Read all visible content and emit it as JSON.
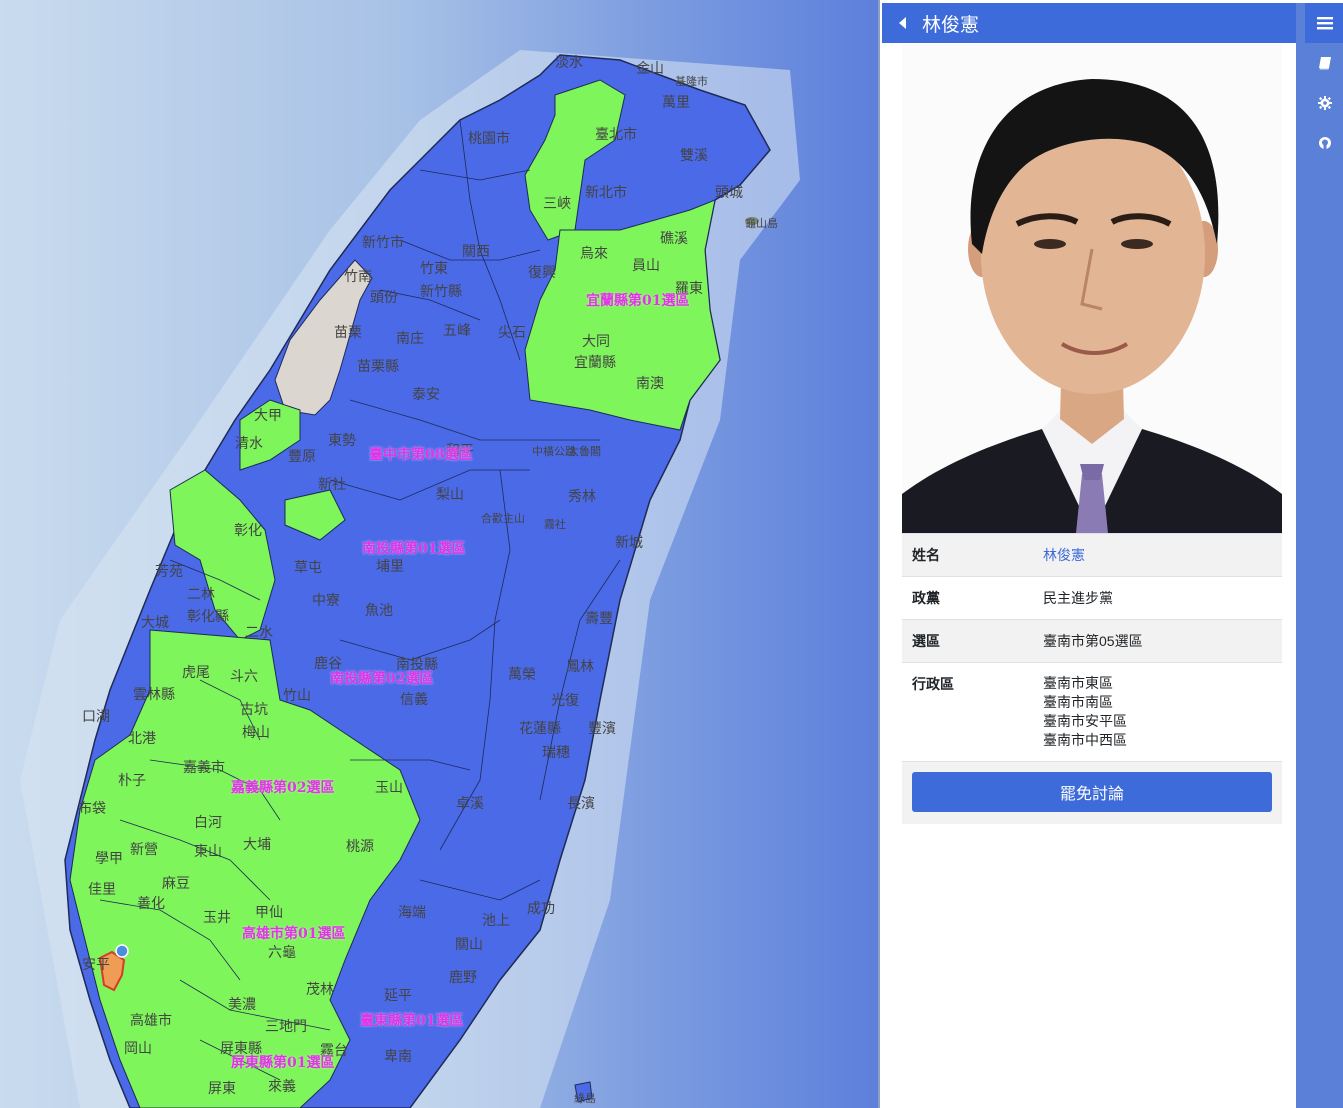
{
  "sidebar": {
    "title": "林俊憲",
    "back_icon": "caret-left-icon",
    "tabs": [
      {
        "icon": "menu-icon"
      },
      {
        "icon": "book-icon"
      },
      {
        "icon": "gear-icon"
      },
      {
        "icon": "github-icon"
      }
    ],
    "info": {
      "name_label": "姓名",
      "name_value": "林俊憲",
      "party_label": "政黨",
      "party_value": "民主進步黨",
      "constituency_label": "選區",
      "constituency_value": "臺南市第05選區",
      "district_label": "行政區",
      "districts": [
        "臺南市東區",
        "臺南市南區",
        "臺南市安平區",
        "臺南市中西區"
      ]
    },
    "recall_button": "罷免討論"
  },
  "map": {
    "colors": {
      "dpp": "#7ef55a",
      "kmt": "#4a6ae8",
      "selected": "#ef9d55",
      "other": "#dcd6d0"
    },
    "district_labels": [
      "宜蘭縣第01選區",
      "臺中市第08選區",
      "南投縣第01選區",
      "南投縣第02選區",
      "嘉義縣第02選區",
      "高雄市第01選區",
      "臺東縣第01選區",
      "屏東縣第01選區"
    ],
    "place_labels": [
      "淡水",
      "金山",
      "基隆市",
      "萬里",
      "桃園市",
      "臺北市",
      "雙溪",
      "新北市",
      "頭城",
      "龜山島",
      "三峽",
      "新竹市",
      "關西",
      "竹東",
      "新竹縣",
      "復興",
      "烏來",
      "礁溪",
      "員山",
      "羅東",
      "竹南",
      "頭份",
      "苗栗",
      "南庄",
      "五峰",
      "尖石",
      "大同",
      "宜蘭縣",
      "苗栗縣",
      "泰安",
      "南澳",
      "大甲",
      "和平",
      "清水",
      "中橫公路",
      "太魯閣",
      "東勢",
      "豐原",
      "新社",
      "梨山",
      "秀林",
      "合歡主山",
      "彰化",
      "霧社",
      "新城",
      "芳苑",
      "二林",
      "彰化縣",
      "草屯",
      "埔里",
      "中寮",
      "魚池",
      "二水",
      "壽豐",
      "大城",
      "竹山",
      "南投縣",
      "鹿谷",
      "斗六",
      "信義",
      "鳳林",
      "雲林縣",
      "虎尾",
      "萬榮",
      "古坑",
      "光復",
      "口湖",
      "北港",
      "梅山",
      "花蓮縣",
      "豐濱",
      "瑞穗",
      "朴子",
      "嘉義市",
      "布袋",
      "白河",
      "大埔",
      "玉山",
      "長濱",
      "卓溪",
      "新營",
      "東山",
      "學甲",
      "佳里",
      "麻豆",
      "桃源",
      "善化",
      "玉井",
      "甲仙",
      "海端",
      "池上",
      "成功",
      "安平",
      "六龜",
      "關山",
      "鹿野",
      "美濃",
      "茂林",
      "延平",
      "高雄市",
      "三地門",
      "屏東縣",
      "霧台",
      "卑南",
      "岡山",
      "屏東",
      "來義",
      "綠島"
    ]
  }
}
